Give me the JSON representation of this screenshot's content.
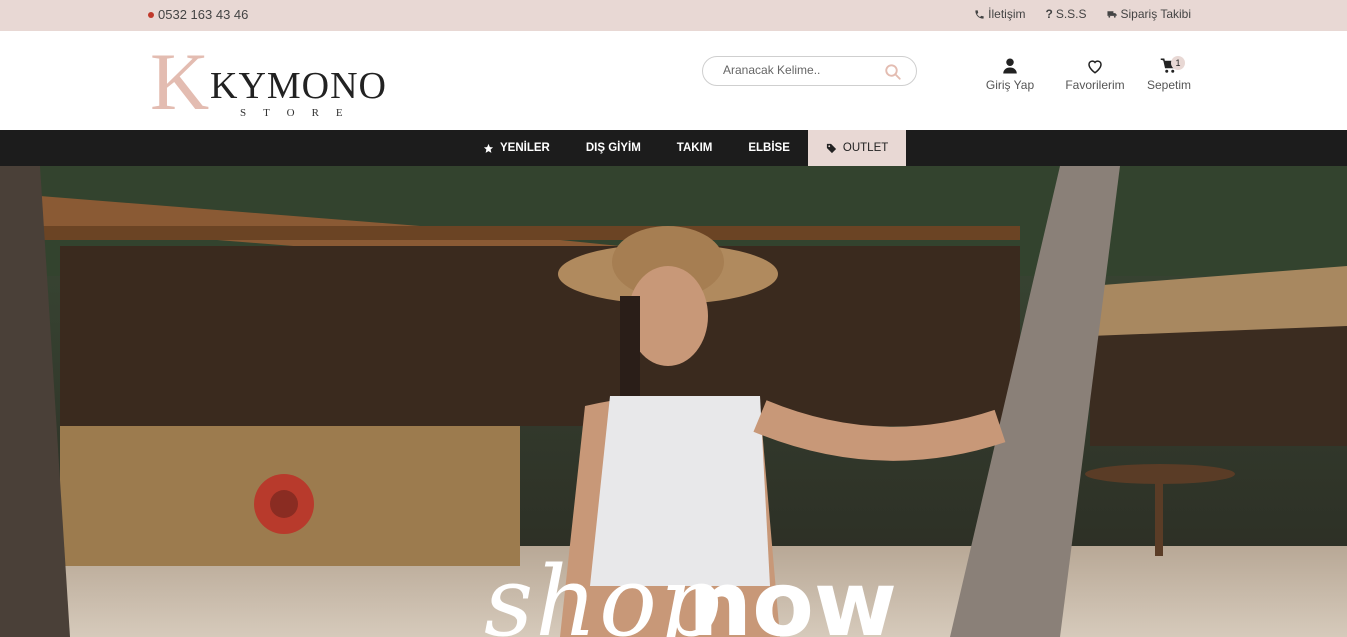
{
  "topbar": {
    "phone": "0532 163 43 46",
    "links": [
      {
        "label": "İletişim",
        "icon": "phone-icon"
      },
      {
        "label": "S.S.S",
        "icon": "question-icon"
      },
      {
        "label": "Sipariş Takibi",
        "icon": "truck-icon"
      }
    ]
  },
  "header": {
    "logo": {
      "initial": "K",
      "name": "KYMONO",
      "sub": "STORE"
    },
    "search": {
      "placeholder": "Aranacak Kelime.."
    },
    "actions": {
      "login": "Giriş Yap",
      "favorites": "Favorilerim",
      "cart": "Sepetim",
      "cart_count": "1"
    }
  },
  "nav": {
    "items": [
      "YENİLER",
      "DIŞ GİYİM",
      "TAKIM",
      "ELBİSE",
      "OUTLET"
    ]
  },
  "hero": {
    "text_script": "shop",
    "text_bold": "now"
  },
  "colors": {
    "topbar_bg": "#e8d8d4",
    "nav_bg": "#1c1c1c",
    "accent": "#e3bcb1",
    "phone_dot": "#c0392b"
  }
}
